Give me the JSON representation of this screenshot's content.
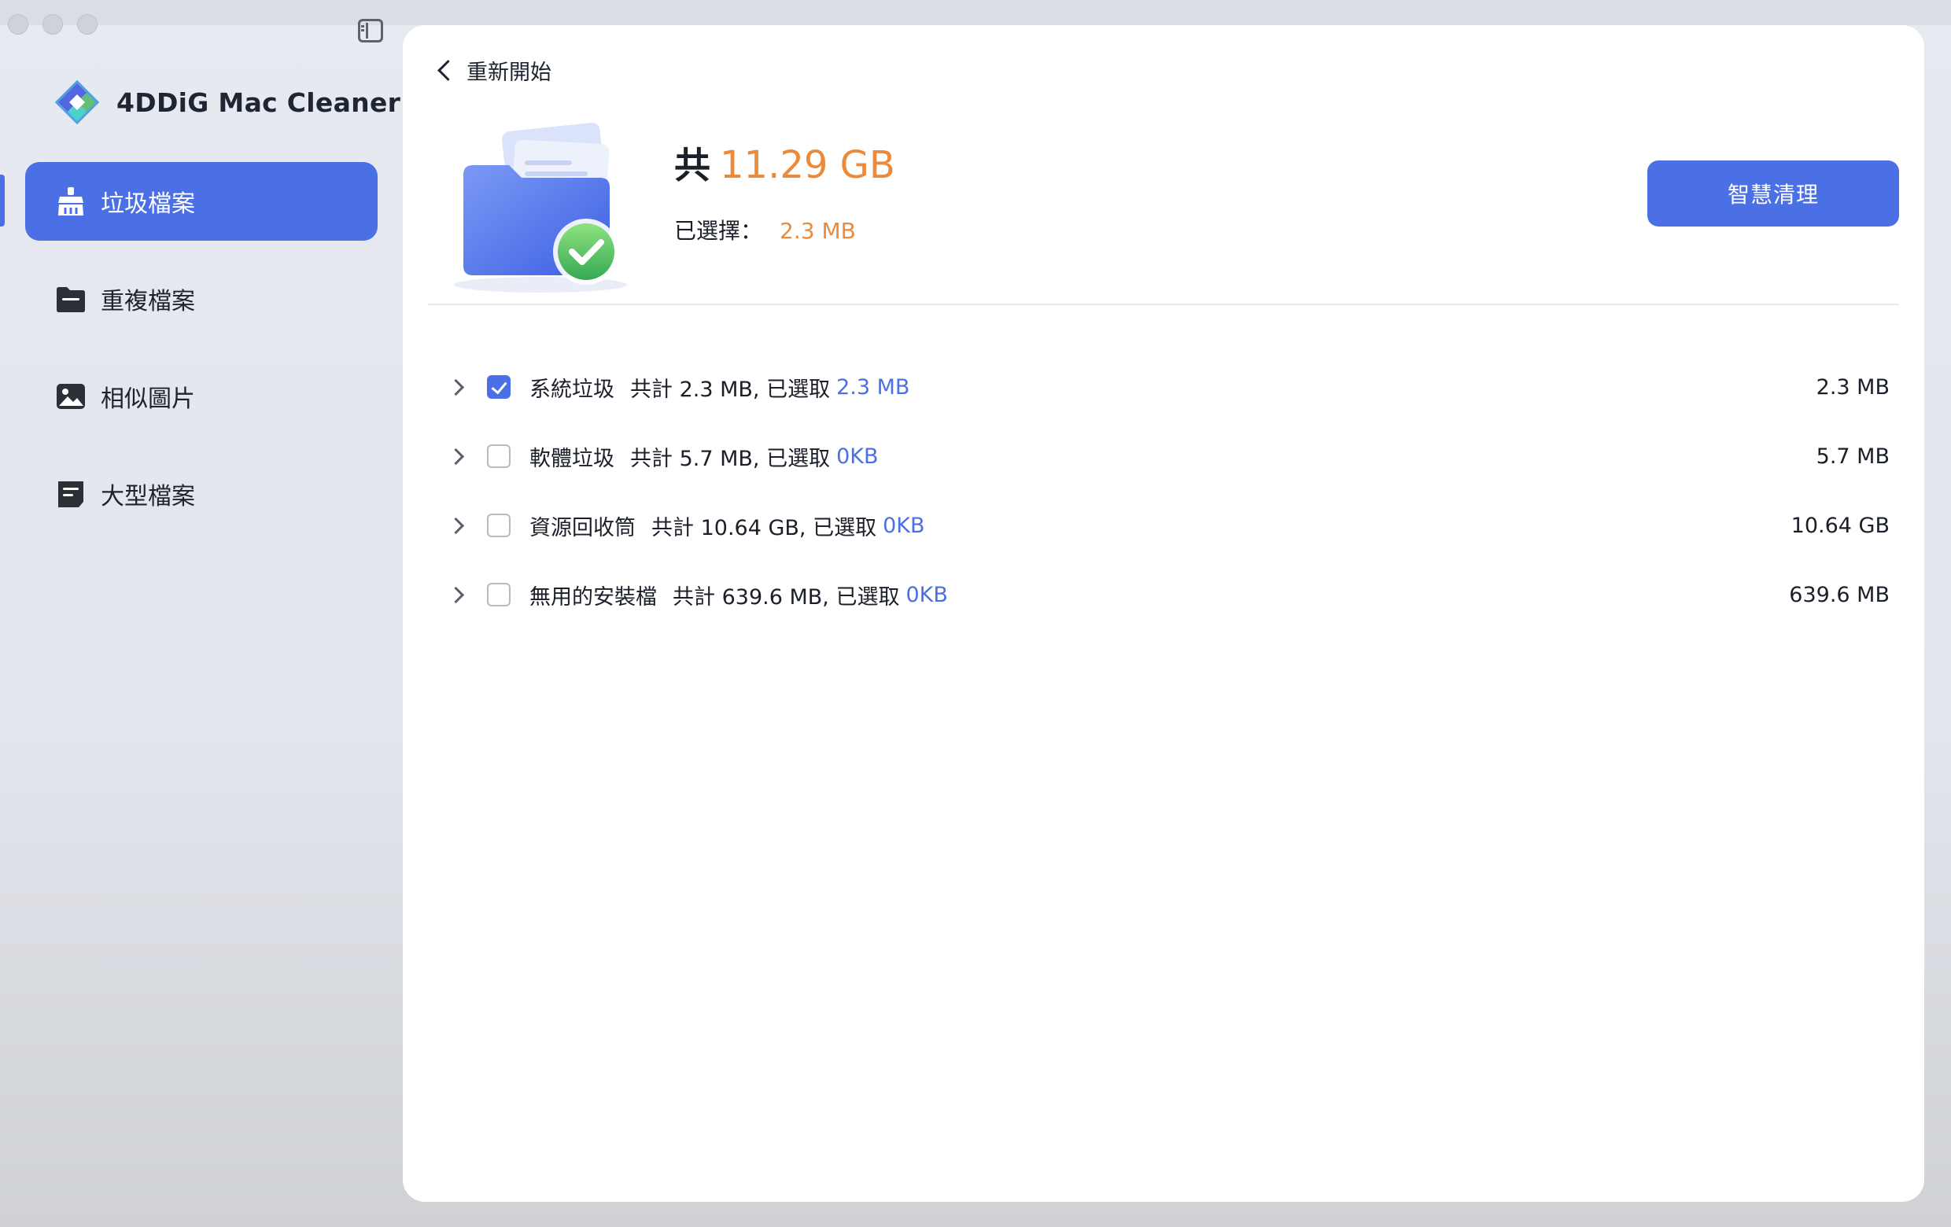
{
  "app": {
    "name": "4DDiG Mac Cleaner"
  },
  "sidebar": {
    "items": [
      {
        "label": "垃圾檔案",
        "icon": "broom-icon",
        "active": true
      },
      {
        "label": "重複檔案",
        "icon": "folder-icon",
        "active": false
      },
      {
        "label": "相似圖片",
        "icon": "image-icon",
        "active": false
      },
      {
        "label": "大型檔案",
        "icon": "large-file-icon",
        "active": false
      }
    ]
  },
  "main": {
    "back_label": "重新開始",
    "total_prefix": "共",
    "total_value": "11.29 GB",
    "selected_label": "已選擇：",
    "selected_value": "2.3 MB",
    "smart_clean_label": "智慧清理",
    "categories": [
      {
        "name": "系統垃圾",
        "info": "共計 2.3 MB, 已選取",
        "selected": "2.3 MB",
        "size": "2.3 MB",
        "checked": true
      },
      {
        "name": "軟體垃圾",
        "info": "共計 5.7 MB, 已選取",
        "selected": "0KB",
        "size": "5.7 MB",
        "checked": false
      },
      {
        "name": "資源回收筒",
        "info": "共計 10.64 GB, 已選取",
        "selected": "0KB",
        "size": "10.64 GB",
        "checked": false
      },
      {
        "name": "無用的安裝檔",
        "info": "共計 639.6 MB, 已選取",
        "selected": "0KB",
        "size": "639.6 MB",
        "checked": false
      }
    ]
  },
  "colors": {
    "accent": "#4b6fe4",
    "highlight": "#ea8a3a"
  }
}
